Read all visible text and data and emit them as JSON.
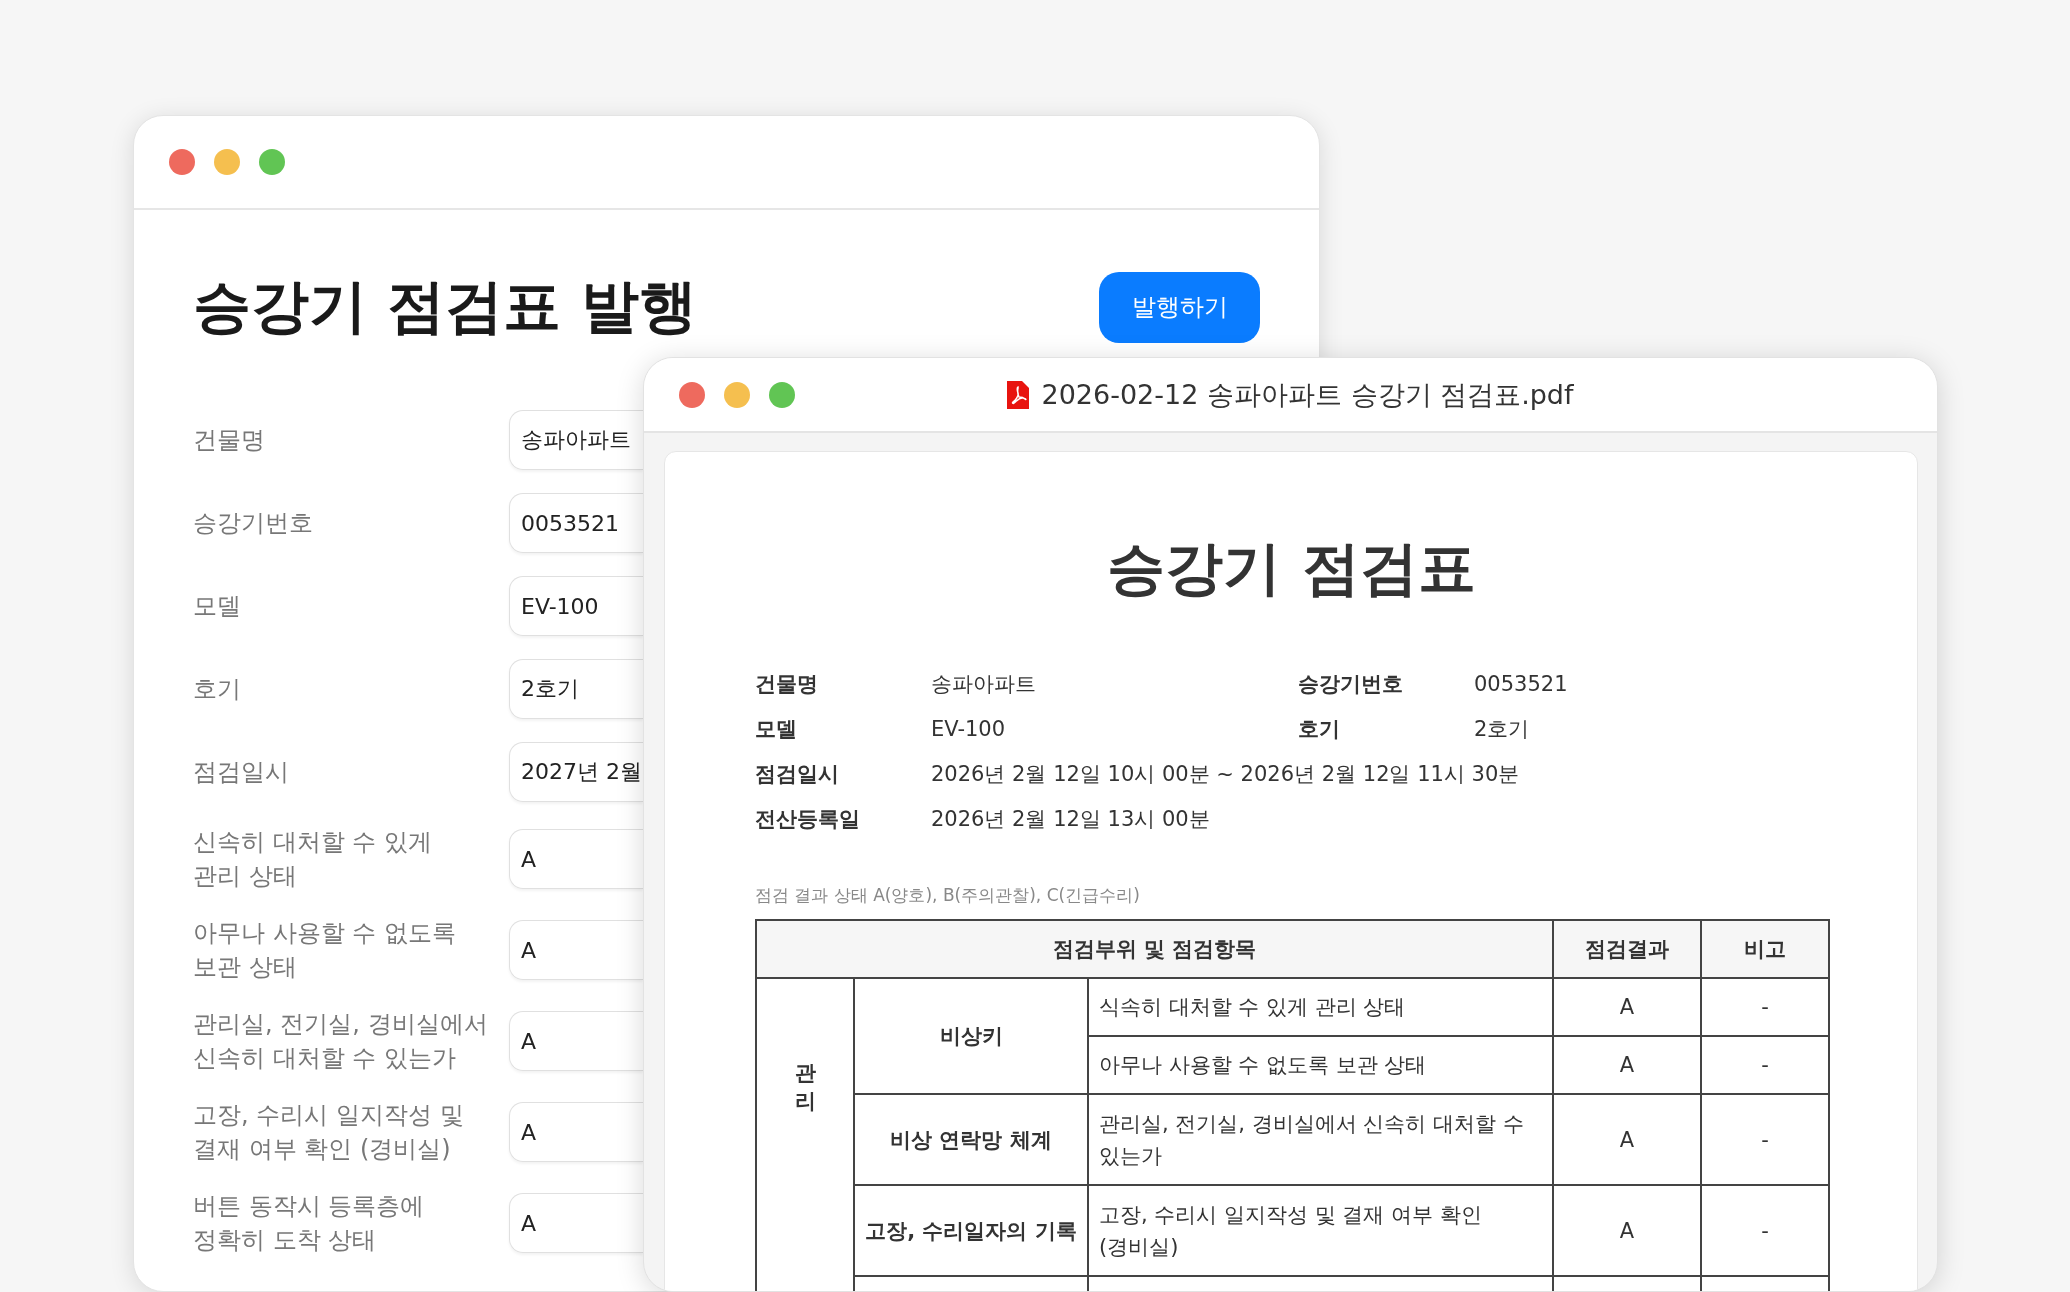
{
  "form_window": {
    "title": "승강기 점검표 발행",
    "publish_button": "발행하기",
    "fields": [
      {
        "label": "건물명",
        "value": "송파아파트"
      },
      {
        "label": "승강기번호",
        "value": "0053521"
      },
      {
        "label": "모델",
        "value": "EV-100"
      },
      {
        "label": "호기",
        "value": "2호기"
      },
      {
        "label": "점검일시",
        "value": "2027년 2월"
      },
      {
        "label": "신속히 대처할 수 있게\n관리 상태",
        "value": "A"
      },
      {
        "label": "아무나 사용할 수 없도록\n보관 상태",
        "value": "A"
      },
      {
        "label": "관리실, 전기실, 경비실에서\n신속히 대처할 수 있는가",
        "value": "A"
      },
      {
        "label": "고장, 수리시 일지작성 및\n결재 여부 확인 (경비실)",
        "value": "A"
      },
      {
        "label": "버튼 동작시 등록층에\n정확히 도착 상태",
        "value": "A"
      }
    ]
  },
  "pdf_window": {
    "title": "2026-02-12 송파아파트 승강기 점검표.pdf",
    "document": {
      "title": "승강기 점검표",
      "info_rows": [
        [
          {
            "label": "건물명",
            "value": "송파아파트"
          },
          {
            "label": "승강기번호",
            "value": "0053521"
          }
        ],
        [
          {
            "label": "모델",
            "value": "EV-100"
          },
          {
            "label": "호기",
            "value": "2호기"
          }
        ],
        [
          {
            "label": "점검일시",
            "value": "2026년 2월 12일 10시 00분 ~ 2026년 2월 12일 11시 30분"
          }
        ],
        [
          {
            "label": "전산등록일",
            "value": "2026년 2월 12일 13시 00분"
          }
        ]
      ],
      "legend": "점검 결과 상태 A(양호), B(주의관찰), C(긴급수리)",
      "table": {
        "columns": [
          "점검부위 및 점검항목",
          "점검결과",
          "비고"
        ],
        "groups": [
          {
            "category": "관리",
            "sections": [
              {
                "name": "비상키",
                "items": [
                  {
                    "text": "식속히 대처할 수 있게 관리 상태",
                    "result": "A",
                    "note": "-"
                  },
                  {
                    "text": "아무나 사용할 수 없도록 보관 상태",
                    "result": "A",
                    "note": "-"
                  }
                ]
              },
              {
                "name": "비상 연락망 체계",
                "items": [
                  {
                    "text": "관리실, 전기실, 경비실에서 신속히 대처할 수\n있는가",
                    "result": "A",
                    "note": "-"
                  }
                ]
              },
              {
                "name": "고장, 수리일자의 기록",
                "items": [
                  {
                    "text": "고장, 수리시 일지작성 및 결재 여부 확인\n(경비실)",
                    "result": "A",
                    "note": "-"
                  }
                ]
              }
            ]
          }
        ]
      }
    }
  }
}
